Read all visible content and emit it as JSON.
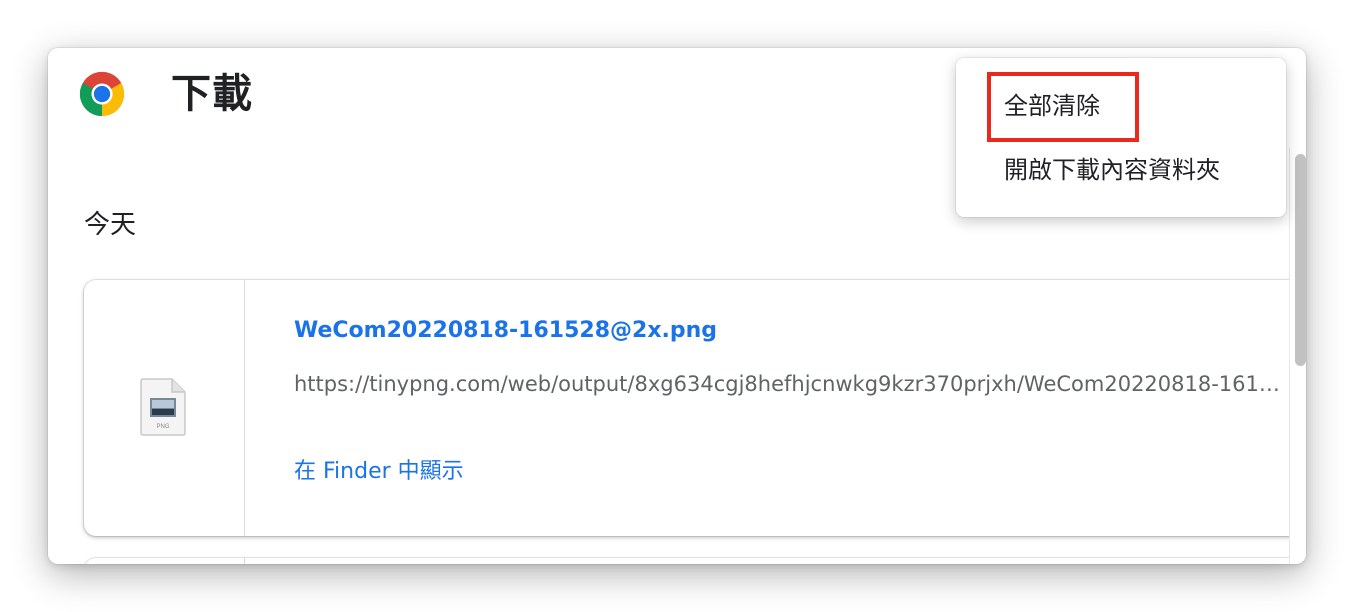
{
  "header": {
    "title": "下載",
    "logo_icon": "chrome-logo-icon"
  },
  "section": {
    "label": "今天"
  },
  "downloads": [
    {
      "file_name": "WeCom20220818-161528@2x.png",
      "url": "https://tinypng.com/web/output/8xg634cgj8hefhjcnwkg9kzr370prjxh/WeCom20220818-161528@2x.png",
      "action_label": "在 Finder 中顯示",
      "file_icon": "png-file-icon",
      "file_type_label": "PNG"
    }
  ],
  "menu": {
    "items": [
      {
        "label": "全部清除"
      },
      {
        "label": "開啟下載內容資料夾"
      }
    ],
    "highlight_color": "#e8291c"
  },
  "colors": {
    "link": "#1a73e8",
    "text": "#202124",
    "secondary_text": "#5f6368"
  }
}
